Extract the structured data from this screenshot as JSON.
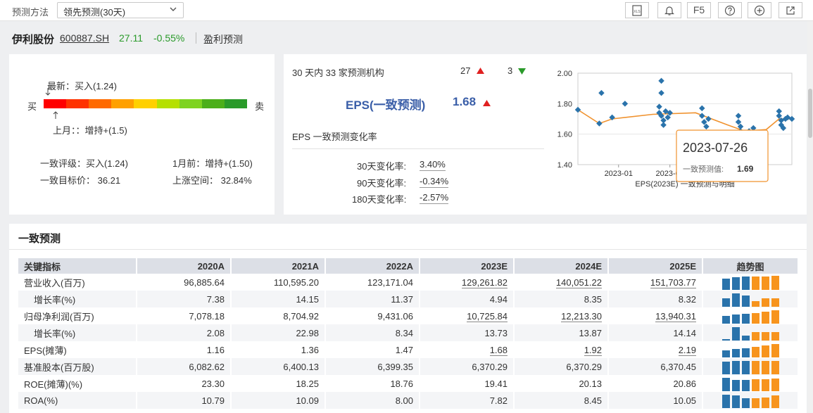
{
  "toolbar": {
    "method_label": "预测方法",
    "method_value": "领先预测(30天)",
    "f5_label": "F5",
    "xls_label": "XLS"
  },
  "stock": {
    "name": "伊利股份",
    "code": "600887.SH",
    "price": "27.11",
    "change": "-0.55%",
    "section": "盈利预测"
  },
  "rating": {
    "latest": "最新：买入(1.24)",
    "last_month": "上月：：增持+(1.5)",
    "buy": "买",
    "sell": "卖",
    "latest_position": 0.02,
    "last_month_position": 0.06,
    "scale_colors": [
      "#ff0000",
      "#ff3300",
      "#ff6a00",
      "#ffa000",
      "#ffd000",
      "#b5e000",
      "#7ed321",
      "#4caf1a",
      "#2a9a2a"
    ],
    "consensus": "一致评级：买入(1.24)",
    "one_month_ago": "1月前：增持+(1.50)",
    "target_price": "一致目标价：  36.21",
    "upside": "上涨空间：  32.84%"
  },
  "forecast": {
    "institutions": "30 天内 33 家预测机构",
    "up_count": "27",
    "down_count": "3",
    "eps_label": "EPS(一致预测)",
    "eps_value": "1.68",
    "change_title": "EPS 一致预测变化率",
    "rates": [
      {
        "label": "30天变化率:",
        "value": "3.40%"
      },
      {
        "label": "90天变化率:",
        "value": "-0.34%"
      },
      {
        "label": "180天变化率:",
        "value": "-2.57%"
      }
    ]
  },
  "chart_data": {
    "type": "scatter",
    "title": "EPS(2023E) 一致预测与明细",
    "yticks": [
      "2.00",
      "1.80",
      "1.60",
      "1.40"
    ],
    "xticks": [
      "2023-01",
      "2023-05"
    ],
    "ylim": [
      1.4,
      2.0
    ],
    "xlim": [
      0,
      100
    ],
    "line": [
      [
        0,
        1.76
      ],
      [
        10,
        1.67
      ],
      [
        16,
        1.7
      ],
      [
        35,
        1.73
      ],
      [
        55,
        1.74
      ],
      [
        70,
        1.66
      ],
      [
        78,
        1.62
      ],
      [
        88,
        1.63
      ],
      [
        94,
        1.7
      ],
      [
        100,
        1.7
      ]
    ],
    "points": [
      [
        0,
        1.76
      ],
      [
        10,
        1.67
      ],
      [
        11,
        1.87
      ],
      [
        16,
        1.71
      ],
      [
        22,
        1.8
      ],
      [
        39,
        1.95
      ],
      [
        39,
        1.87
      ],
      [
        38,
        1.78
      ],
      [
        38,
        1.74
      ],
      [
        39,
        1.72
      ],
      [
        40,
        1.69
      ],
      [
        40,
        1.66
      ],
      [
        41,
        1.75
      ],
      [
        42,
        1.71
      ],
      [
        43,
        1.74
      ],
      [
        58,
        1.77
      ],
      [
        58,
        1.72
      ],
      [
        59,
        1.68
      ],
      [
        60,
        1.65
      ],
      [
        61,
        1.7
      ],
      [
        75,
        1.72
      ],
      [
        75,
        1.68
      ],
      [
        76,
        1.65
      ],
      [
        76,
        1.62
      ],
      [
        77,
        1.6
      ],
      [
        78,
        1.57
      ],
      [
        80,
        1.62
      ],
      [
        82,
        1.64
      ],
      [
        94,
        1.75
      ],
      [
        94,
        1.72
      ],
      [
        95,
        1.69
      ],
      [
        95,
        1.66
      ],
      [
        96,
        1.64
      ],
      [
        97,
        1.7
      ],
      [
        98,
        1.71
      ],
      [
        100,
        1.7
      ]
    ],
    "tooltip": {
      "date": "2023-07-26",
      "label": "一致预测值:",
      "value": "1.69"
    }
  },
  "table": {
    "section_title": "一致预测",
    "headers": [
      "关键指标",
      "2020A",
      "2021A",
      "2022A",
      "2023E",
      "2024E",
      "2025E",
      "趋势图"
    ],
    "rows": [
      {
        "name": "营业收入(百万)",
        "sub": false,
        "values": [
          "96,885.64",
          "110,595.20",
          "123,171.04",
          "129,261.82",
          "140,051.22",
          "151,703.77"
        ],
        "ul": true,
        "trend": [
          0.82,
          0.9,
          0.97,
          0.95,
          0.97,
          0.98
        ]
      },
      {
        "name": "增长率(%)",
        "sub": true,
        "values": [
          "7.38",
          "14.15",
          "11.37",
          "4.94",
          "8.35",
          "8.32"
        ],
        "ul": false,
        "trend": [
          0.6,
          0.95,
          0.82,
          0.38,
          0.62,
          0.62
        ]
      },
      {
        "name": "归母净利润(百万)",
        "sub": false,
        "values": [
          "7,078.18",
          "8,704.92",
          "9,431.06",
          "10,725.84",
          "12,213.30",
          "13,940.31"
        ],
        "ul": true,
        "trend": [
          0.55,
          0.65,
          0.7,
          0.77,
          0.87,
          0.97
        ]
      },
      {
        "name": "增长率(%)",
        "sub": true,
        "values": [
          "2.08",
          "22.98",
          "8.34",
          "13.73",
          "13.87",
          "14.14"
        ],
        "ul": false,
        "trend": [
          0.1,
          0.95,
          0.35,
          0.6,
          0.6,
          0.6
        ]
      },
      {
        "name": "EPS(摊薄)",
        "sub": false,
        "values": [
          "1.16",
          "1.36",
          "1.47",
          "1.68",
          "1.92",
          "2.19"
        ],
        "ul": true,
        "trend": [
          0.5,
          0.6,
          0.65,
          0.75,
          0.85,
          0.97
        ]
      },
      {
        "name": "基准股本(百万股)",
        "sub": false,
        "values": [
          "6,082.62",
          "6,400.13",
          "6,399.35",
          "6,370.29",
          "6,370.29",
          "6,370.45"
        ],
        "ul": false,
        "trend": [
          0.92,
          0.97,
          0.97,
          0.96,
          0.96,
          0.96
        ]
      },
      {
        "name": "ROE(摊薄)(%)",
        "sub": false,
        "values": [
          "23.30",
          "18.25",
          "18.76",
          "19.41",
          "20.13",
          "20.86"
        ],
        "ul": false,
        "trend": [
          0.97,
          0.78,
          0.8,
          0.83,
          0.86,
          0.9
        ]
      },
      {
        "name": "ROA(%)",
        "sub": false,
        "values": [
          "10.79",
          "10.09",
          "8.00",
          "7.82",
          "8.45",
          "10.05"
        ],
        "ul": false,
        "trend": [
          0.97,
          0.9,
          0.72,
          0.7,
          0.76,
          0.9
        ]
      }
    ],
    "trend_colors": {
      "actual": "#2a73ab",
      "estimate": "#f7941d"
    }
  },
  "colors": {
    "up": "#e02020",
    "down": "#2a9a2a",
    "accent": "#3a5ea8"
  }
}
